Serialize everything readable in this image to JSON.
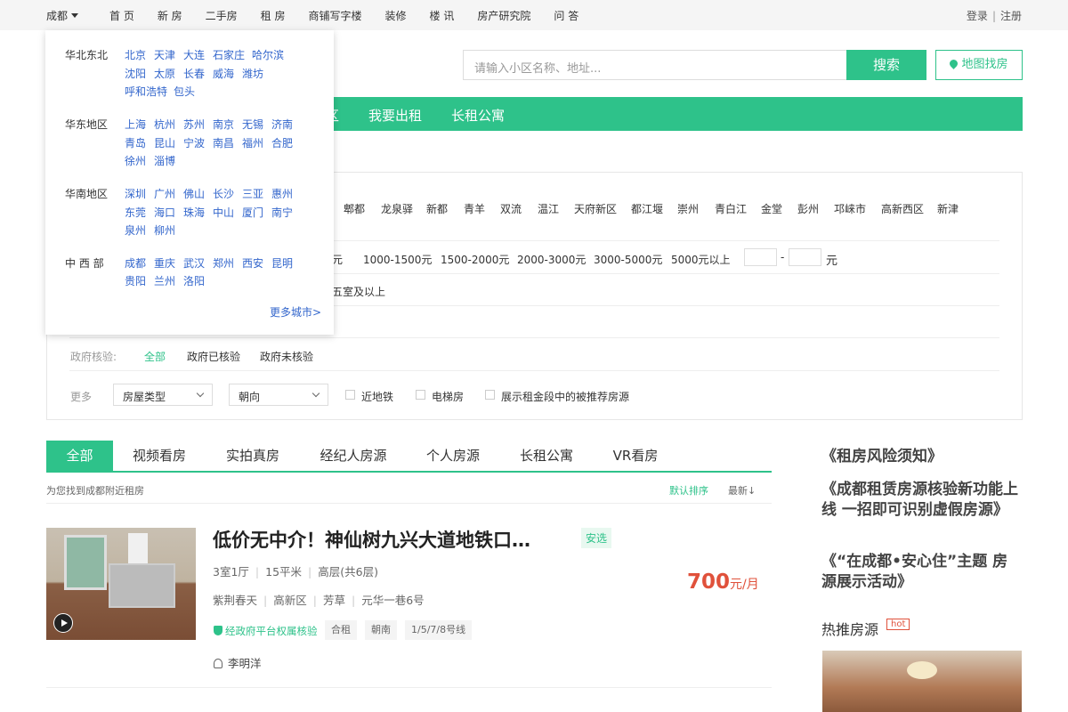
{
  "topbar": {
    "city": "成都",
    "nav": [
      "首 页",
      "新 房",
      "二手房",
      "租 房",
      "商铺写字楼",
      "装修",
      "楼 讯",
      "房产研究院",
      "问 答"
    ],
    "login": "登录",
    "register": "注册"
  },
  "header": {
    "search_placeholder": "请输入小区名称、地址...",
    "search_button": "搜索",
    "map_button": "地图找房"
  },
  "greennav": {
    "partial": "区",
    "items": [
      "我要出租",
      "长租公寓"
    ]
  },
  "filters": {
    "districts": [
      "郫都",
      "龙泉驿",
      "新都",
      "青羊",
      "双流",
      "温江",
      "天府新区",
      "都江堰",
      "崇州",
      "青白江",
      "金堂",
      "彭州",
      "邛崃市",
      "高新西区",
      "新津"
    ],
    "price_partial": "元",
    "prices": [
      "1000-1500元",
      "1500-2000元",
      "2000-3000元",
      "3000-5000元",
      "5000元以上"
    ],
    "price_unit": "元",
    "price_dash": "-",
    "rooms_partial": "五室及以上",
    "gov_label": "政府核验:",
    "gov_options": [
      "全部",
      "政府已核验",
      "政府未核验"
    ],
    "more_label": "更多",
    "house_type": "房屋类型",
    "orientation": "朝向",
    "checks": [
      "近地铁",
      "电梯房",
      "展示租金段中的被推荐房源"
    ]
  },
  "city_dropdown": {
    "regions": [
      {
        "label": "华北东北",
        "rows": [
          [
            "北京",
            "天津",
            "大连",
            "石家庄",
            "哈尔滨"
          ],
          [
            "沈阳",
            "太原",
            "长春",
            "威海",
            "潍坊"
          ],
          [
            "呼和浩特",
            "包头"
          ]
        ]
      },
      {
        "label": "华东地区",
        "rows": [
          [
            "上海",
            "杭州",
            "苏州",
            "南京",
            "无锡",
            "济南"
          ],
          [
            "青岛",
            "昆山",
            "宁波",
            "南昌",
            "福州",
            "合肥"
          ],
          [
            "徐州",
            "淄博"
          ]
        ]
      },
      {
        "label": "华南地区",
        "rows": [
          [
            "深圳",
            "广州",
            "佛山",
            "长沙",
            "三亚",
            "惠州"
          ],
          [
            "东莞",
            "海口",
            "珠海",
            "中山",
            "厦门",
            "南宁"
          ],
          [
            "泉州",
            "柳州"
          ]
        ]
      },
      {
        "label": "中 西 部",
        "rows": [
          [
            "成都",
            "重庆",
            "武汉",
            "郑州",
            "西安",
            "昆明"
          ],
          [
            "贵阳",
            "兰州",
            "洛阳"
          ]
        ]
      }
    ],
    "more": "更多城市>"
  },
  "tabs": [
    "全部",
    "视频看房",
    "实拍真房",
    "经纪人房源",
    "个人房源",
    "长租公寓",
    "VR看房"
  ],
  "results": {
    "found": "为您找到成都附近租房",
    "sort_default": "默认排序",
    "sort_new": "最新↓"
  },
  "listing": {
    "title": "低价无中介！神仙树九兴大道地铁口…",
    "badge": "安选",
    "layout": "3室1厅",
    "area": "15平米",
    "floor": "高层(共6层)",
    "community": "紫荆春天",
    "district": "高新区",
    "area_name": "芳草",
    "address": "元华一巷6号",
    "verified": "经政府平台权属核验",
    "tags": [
      "合租",
      "朝南",
      "1/5/7/8号线"
    ],
    "agent": "李明洋",
    "price": "700",
    "price_unit": "元/月"
  },
  "sidebar": {
    "links": [
      "《租房风险须知》",
      "《成都租赁房源核验新功能上线 一招即可识别虚假房源》",
      "《“在成都•安心住”主题 房源展示活动》"
    ],
    "hot_title": "热推房源",
    "hot_badge": "hot"
  },
  "colors": {
    "accent": "#2ec28a",
    "price": "#e0513b",
    "link": "#3366cc"
  }
}
